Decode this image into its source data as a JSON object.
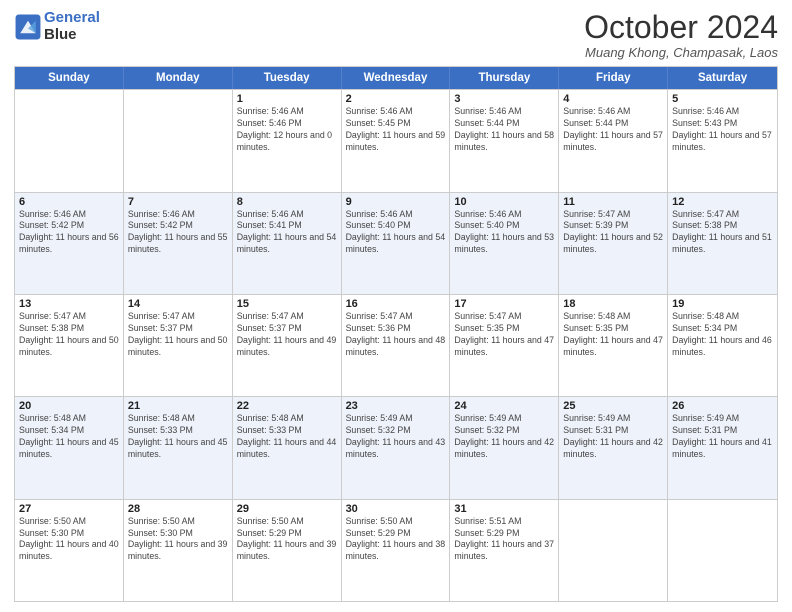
{
  "header": {
    "logo_line1": "General",
    "logo_line2": "Blue",
    "month": "October 2024",
    "location": "Muang Khong, Champasak, Laos"
  },
  "days_of_week": [
    "Sunday",
    "Monday",
    "Tuesday",
    "Wednesday",
    "Thursday",
    "Friday",
    "Saturday"
  ],
  "weeks": [
    [
      {
        "day": "",
        "sunrise": "",
        "sunset": "",
        "daylight": "",
        "empty": true
      },
      {
        "day": "",
        "sunrise": "",
        "sunset": "",
        "daylight": "",
        "empty": true
      },
      {
        "day": "1",
        "sunrise": "Sunrise: 5:46 AM",
        "sunset": "Sunset: 5:46 PM",
        "daylight": "Daylight: 12 hours and 0 minutes.",
        "empty": false
      },
      {
        "day": "2",
        "sunrise": "Sunrise: 5:46 AM",
        "sunset": "Sunset: 5:45 PM",
        "daylight": "Daylight: 11 hours and 59 minutes.",
        "empty": false
      },
      {
        "day": "3",
        "sunrise": "Sunrise: 5:46 AM",
        "sunset": "Sunset: 5:44 PM",
        "daylight": "Daylight: 11 hours and 58 minutes.",
        "empty": false
      },
      {
        "day": "4",
        "sunrise": "Sunrise: 5:46 AM",
        "sunset": "Sunset: 5:44 PM",
        "daylight": "Daylight: 11 hours and 57 minutes.",
        "empty": false
      },
      {
        "day": "5",
        "sunrise": "Sunrise: 5:46 AM",
        "sunset": "Sunset: 5:43 PM",
        "daylight": "Daylight: 11 hours and 57 minutes.",
        "empty": false
      }
    ],
    [
      {
        "day": "6",
        "sunrise": "Sunrise: 5:46 AM",
        "sunset": "Sunset: 5:42 PM",
        "daylight": "Daylight: 11 hours and 56 minutes.",
        "empty": false
      },
      {
        "day": "7",
        "sunrise": "Sunrise: 5:46 AM",
        "sunset": "Sunset: 5:42 PM",
        "daylight": "Daylight: 11 hours and 55 minutes.",
        "empty": false
      },
      {
        "day": "8",
        "sunrise": "Sunrise: 5:46 AM",
        "sunset": "Sunset: 5:41 PM",
        "daylight": "Daylight: 11 hours and 54 minutes.",
        "empty": false
      },
      {
        "day": "9",
        "sunrise": "Sunrise: 5:46 AM",
        "sunset": "Sunset: 5:40 PM",
        "daylight": "Daylight: 11 hours and 54 minutes.",
        "empty": false
      },
      {
        "day": "10",
        "sunrise": "Sunrise: 5:46 AM",
        "sunset": "Sunset: 5:40 PM",
        "daylight": "Daylight: 11 hours and 53 minutes.",
        "empty": false
      },
      {
        "day": "11",
        "sunrise": "Sunrise: 5:47 AM",
        "sunset": "Sunset: 5:39 PM",
        "daylight": "Daylight: 11 hours and 52 minutes.",
        "empty": false
      },
      {
        "day": "12",
        "sunrise": "Sunrise: 5:47 AM",
        "sunset": "Sunset: 5:38 PM",
        "daylight": "Daylight: 11 hours and 51 minutes.",
        "empty": false
      }
    ],
    [
      {
        "day": "13",
        "sunrise": "Sunrise: 5:47 AM",
        "sunset": "Sunset: 5:38 PM",
        "daylight": "Daylight: 11 hours and 50 minutes.",
        "empty": false
      },
      {
        "day": "14",
        "sunrise": "Sunrise: 5:47 AM",
        "sunset": "Sunset: 5:37 PM",
        "daylight": "Daylight: 11 hours and 50 minutes.",
        "empty": false
      },
      {
        "day": "15",
        "sunrise": "Sunrise: 5:47 AM",
        "sunset": "Sunset: 5:37 PM",
        "daylight": "Daylight: 11 hours and 49 minutes.",
        "empty": false
      },
      {
        "day": "16",
        "sunrise": "Sunrise: 5:47 AM",
        "sunset": "Sunset: 5:36 PM",
        "daylight": "Daylight: 11 hours and 48 minutes.",
        "empty": false
      },
      {
        "day": "17",
        "sunrise": "Sunrise: 5:47 AM",
        "sunset": "Sunset: 5:35 PM",
        "daylight": "Daylight: 11 hours and 47 minutes.",
        "empty": false
      },
      {
        "day": "18",
        "sunrise": "Sunrise: 5:48 AM",
        "sunset": "Sunset: 5:35 PM",
        "daylight": "Daylight: 11 hours and 47 minutes.",
        "empty": false
      },
      {
        "day": "19",
        "sunrise": "Sunrise: 5:48 AM",
        "sunset": "Sunset: 5:34 PM",
        "daylight": "Daylight: 11 hours and 46 minutes.",
        "empty": false
      }
    ],
    [
      {
        "day": "20",
        "sunrise": "Sunrise: 5:48 AM",
        "sunset": "Sunset: 5:34 PM",
        "daylight": "Daylight: 11 hours and 45 minutes.",
        "empty": false
      },
      {
        "day": "21",
        "sunrise": "Sunrise: 5:48 AM",
        "sunset": "Sunset: 5:33 PM",
        "daylight": "Daylight: 11 hours and 45 minutes.",
        "empty": false
      },
      {
        "day": "22",
        "sunrise": "Sunrise: 5:48 AM",
        "sunset": "Sunset: 5:33 PM",
        "daylight": "Daylight: 11 hours and 44 minutes.",
        "empty": false
      },
      {
        "day": "23",
        "sunrise": "Sunrise: 5:49 AM",
        "sunset": "Sunset: 5:32 PM",
        "daylight": "Daylight: 11 hours and 43 minutes.",
        "empty": false
      },
      {
        "day": "24",
        "sunrise": "Sunrise: 5:49 AM",
        "sunset": "Sunset: 5:32 PM",
        "daylight": "Daylight: 11 hours and 42 minutes.",
        "empty": false
      },
      {
        "day": "25",
        "sunrise": "Sunrise: 5:49 AM",
        "sunset": "Sunset: 5:31 PM",
        "daylight": "Daylight: 11 hours and 42 minutes.",
        "empty": false
      },
      {
        "day": "26",
        "sunrise": "Sunrise: 5:49 AM",
        "sunset": "Sunset: 5:31 PM",
        "daylight": "Daylight: 11 hours and 41 minutes.",
        "empty": false
      }
    ],
    [
      {
        "day": "27",
        "sunrise": "Sunrise: 5:50 AM",
        "sunset": "Sunset: 5:30 PM",
        "daylight": "Daylight: 11 hours and 40 minutes.",
        "empty": false
      },
      {
        "day": "28",
        "sunrise": "Sunrise: 5:50 AM",
        "sunset": "Sunset: 5:30 PM",
        "daylight": "Daylight: 11 hours and 39 minutes.",
        "empty": false
      },
      {
        "day": "29",
        "sunrise": "Sunrise: 5:50 AM",
        "sunset": "Sunset: 5:29 PM",
        "daylight": "Daylight: 11 hours and 39 minutes.",
        "empty": false
      },
      {
        "day": "30",
        "sunrise": "Sunrise: 5:50 AM",
        "sunset": "Sunset: 5:29 PM",
        "daylight": "Daylight: 11 hours and 38 minutes.",
        "empty": false
      },
      {
        "day": "31",
        "sunrise": "Sunrise: 5:51 AM",
        "sunset": "Sunset: 5:29 PM",
        "daylight": "Daylight: 11 hours and 37 minutes.",
        "empty": false
      },
      {
        "day": "",
        "sunrise": "",
        "sunset": "",
        "daylight": "",
        "empty": true
      },
      {
        "day": "",
        "sunrise": "",
        "sunset": "",
        "daylight": "",
        "empty": true
      }
    ]
  ]
}
